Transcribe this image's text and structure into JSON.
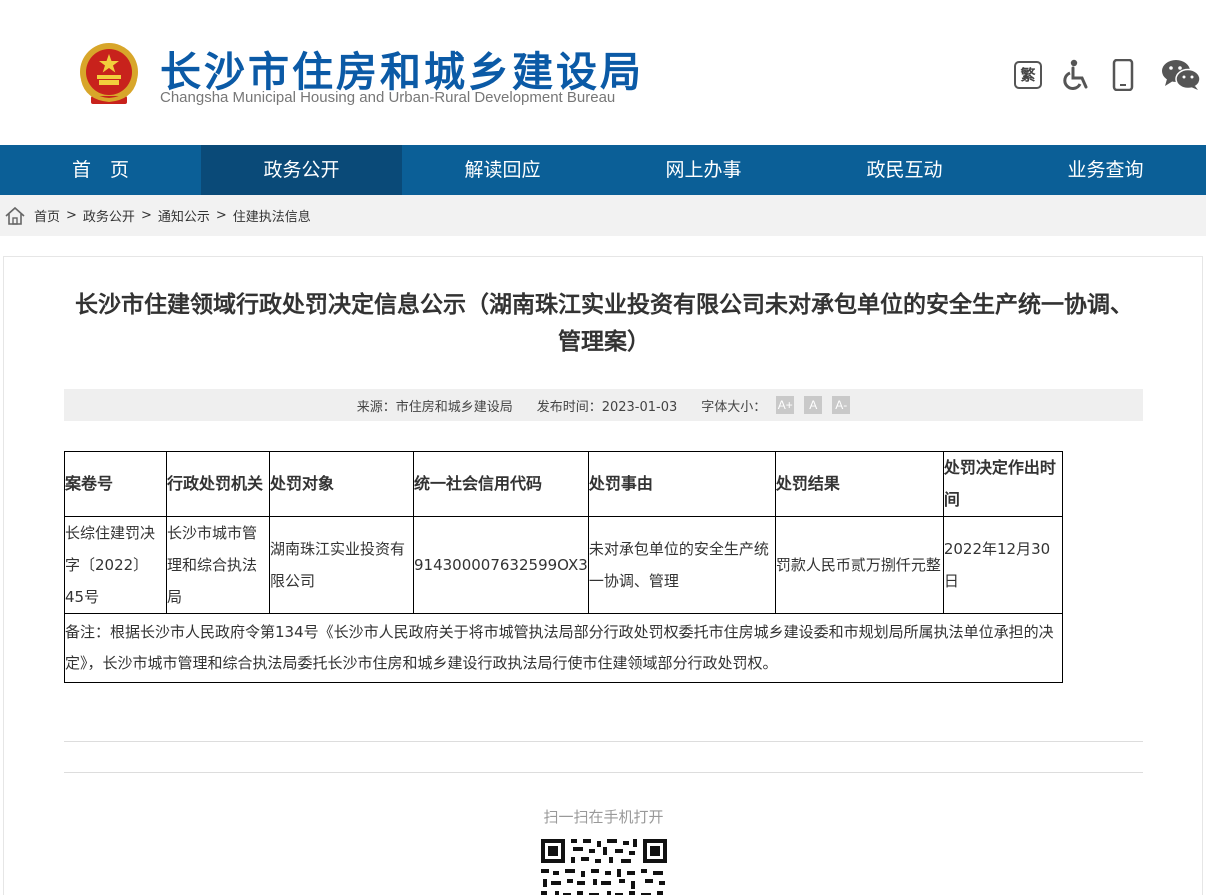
{
  "header": {
    "title": "长沙市住房和城乡建设局",
    "subtitle": "Changsha Municipal Housing and Urban-Rural Development Bureau",
    "tools": {
      "traditional_label": "繁"
    }
  },
  "nav": {
    "items": [
      "首　页",
      "政务公开",
      "解读回应",
      "网上办事",
      "政民互动",
      "业务查询"
    ],
    "active": "政务公开",
    "colors": {
      "bar": "#0b5f97",
      "active": "#0a4a78"
    }
  },
  "breadcrumb": [
    "首页",
    "政务公开",
    "通知公示",
    "住建执法信息"
  ],
  "breadcrumb_separator": ">",
  "article": {
    "title": "长沙市住建领域行政处罚决定信息公示（湖南珠江实业投资有限公司未对承包单位的安全生产统一协调、管理案）",
    "source": "来源：市住房和城乡建设局",
    "publish_time": "发布时间：2023-01-03",
    "font_size_label": "字体大小：",
    "font_sizes": [
      "A+",
      "A",
      "A-"
    ]
  },
  "table": {
    "headers": [
      "案卷号",
      "行政处罚机关",
      "处罚对象",
      "统一社会信用代码",
      "处罚事由",
      "处罚结果",
      "处罚决定作出时间"
    ],
    "row": [
      "长综住建罚决字〔2022〕45号",
      "长沙市城市管理和综合执法局",
      "湖南珠江实业投资有限公司",
      "914300007632599OX3",
      "未对承包单位的安全生产统一协调、管理",
      "罚款人民币贰万捌仟元整",
      "2022年12月30日"
    ],
    "notes": "备注：根据长沙市人民政府令第134号《长沙市人民政府关于将市城管执法局部分行政处罚权委托市住房城乡建设委和市规划局所属执法单位承担的决定》，长沙市城市管理和综合执法局委托长沙市住房和城乡建设行政执法局行使市住建领域部分行政处罚权。"
  },
  "footer": {
    "scan_text": "扫一扫在手机打开"
  }
}
